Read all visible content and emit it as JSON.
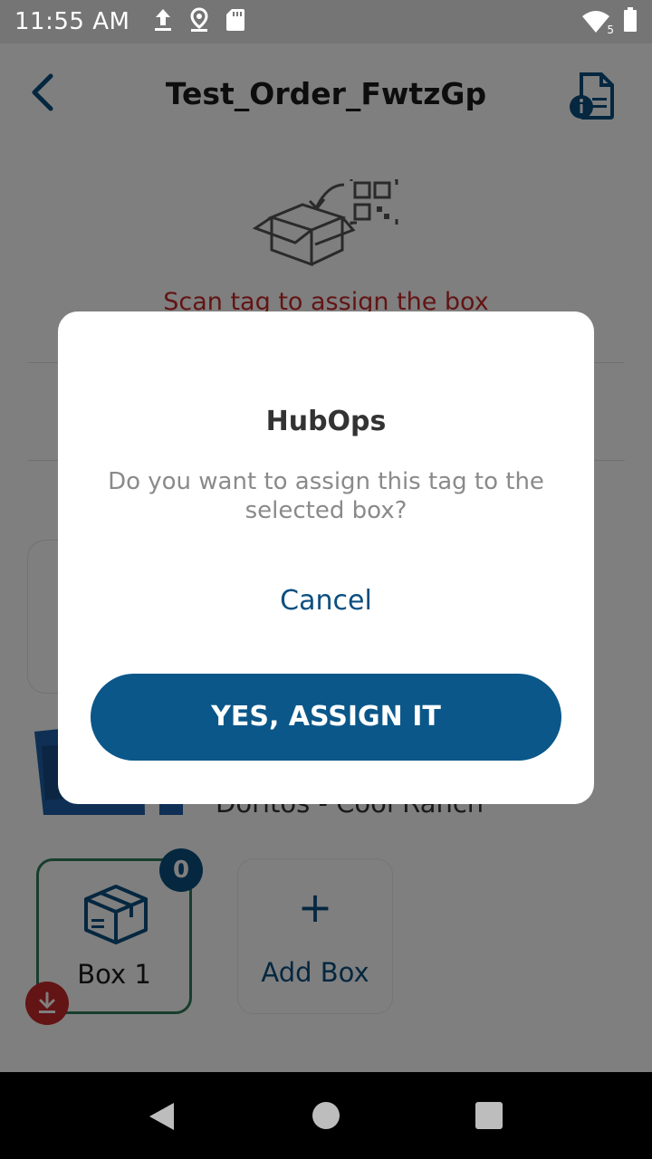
{
  "status_bar": {
    "time": "11:55 AM",
    "icons_left": [
      "upload-icon",
      "location-icon",
      "sd-card-icon"
    ],
    "icons_right": [
      "wifi-icon",
      "battery-icon"
    ],
    "wifi_badge": "5"
  },
  "header": {
    "title": "Test_Order_FwtzGp",
    "back_icon": "chevron-left-icon",
    "info_icon": "document-info-icon"
  },
  "scan": {
    "message": "Scan tag to assign the box",
    "illustration": "box-qr-scan-icon"
  },
  "product": {
    "name": "Doritos - Cool Ranch"
  },
  "boxes": [
    {
      "label": "Box 1",
      "count": "0",
      "selected": true
    }
  ],
  "add_box": {
    "label": "Add Box",
    "icon": "+"
  },
  "dialog": {
    "title": "HubOps",
    "message": "Do you want to assign this tag to the selected box?",
    "cancel_label": "Cancel",
    "confirm_label": "YES, ASSIGN IT"
  },
  "colors": {
    "primary": "#0b5789",
    "accent_red": "#c62828",
    "selected_border": "#2e7d5b",
    "status_bar": "#757575"
  }
}
